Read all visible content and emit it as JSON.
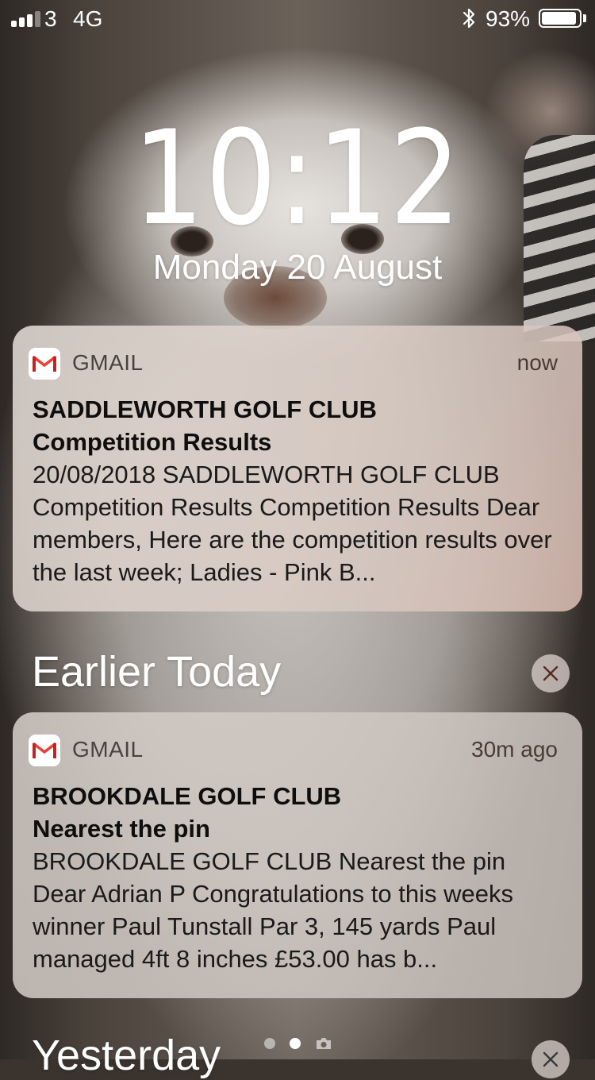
{
  "status_bar": {
    "signal_bars_filled": 3,
    "signal_bars_total": 4,
    "carrier": "3",
    "network": "4G",
    "bluetooth_icon": "bluetooth-icon",
    "battery_percent": "93%",
    "battery_level": 0.93
  },
  "lock_screen": {
    "time": "10:12",
    "date": "Monday 20 August"
  },
  "notifications": [
    {
      "app_icon": "gmail-icon",
      "app": "GMAIL",
      "time": "now",
      "title_line1": "SADDLEWORTH GOLF CLUB",
      "title_line2": "Competition Results",
      "body": "20/08/2018 SADDLEWORTH GOLF CLUB Competition Results Competition Results Dear members, Here are the competition results over the last week; Ladies - Pink B..."
    },
    {
      "app_icon": "gmail-icon",
      "app": "GMAIL",
      "time": "30m ago",
      "title_line1": "BROOKDALE GOLF CLUB",
      "title_line2": "Nearest the pin",
      "body": "BROOKDALE GOLF CLUB Nearest the pin Dear Adrian P Congratulations to this weeks winner Paul Tunstall Par 3, 145 yards Paul managed 4ft 8 inches £53.00 has b..."
    }
  ],
  "sections": {
    "earlier_today": "Earlier Today",
    "yesterday": "Yesterday"
  },
  "page_indicator": {
    "pages": 2,
    "active_page": 2,
    "camera_icon": "camera-icon"
  }
}
